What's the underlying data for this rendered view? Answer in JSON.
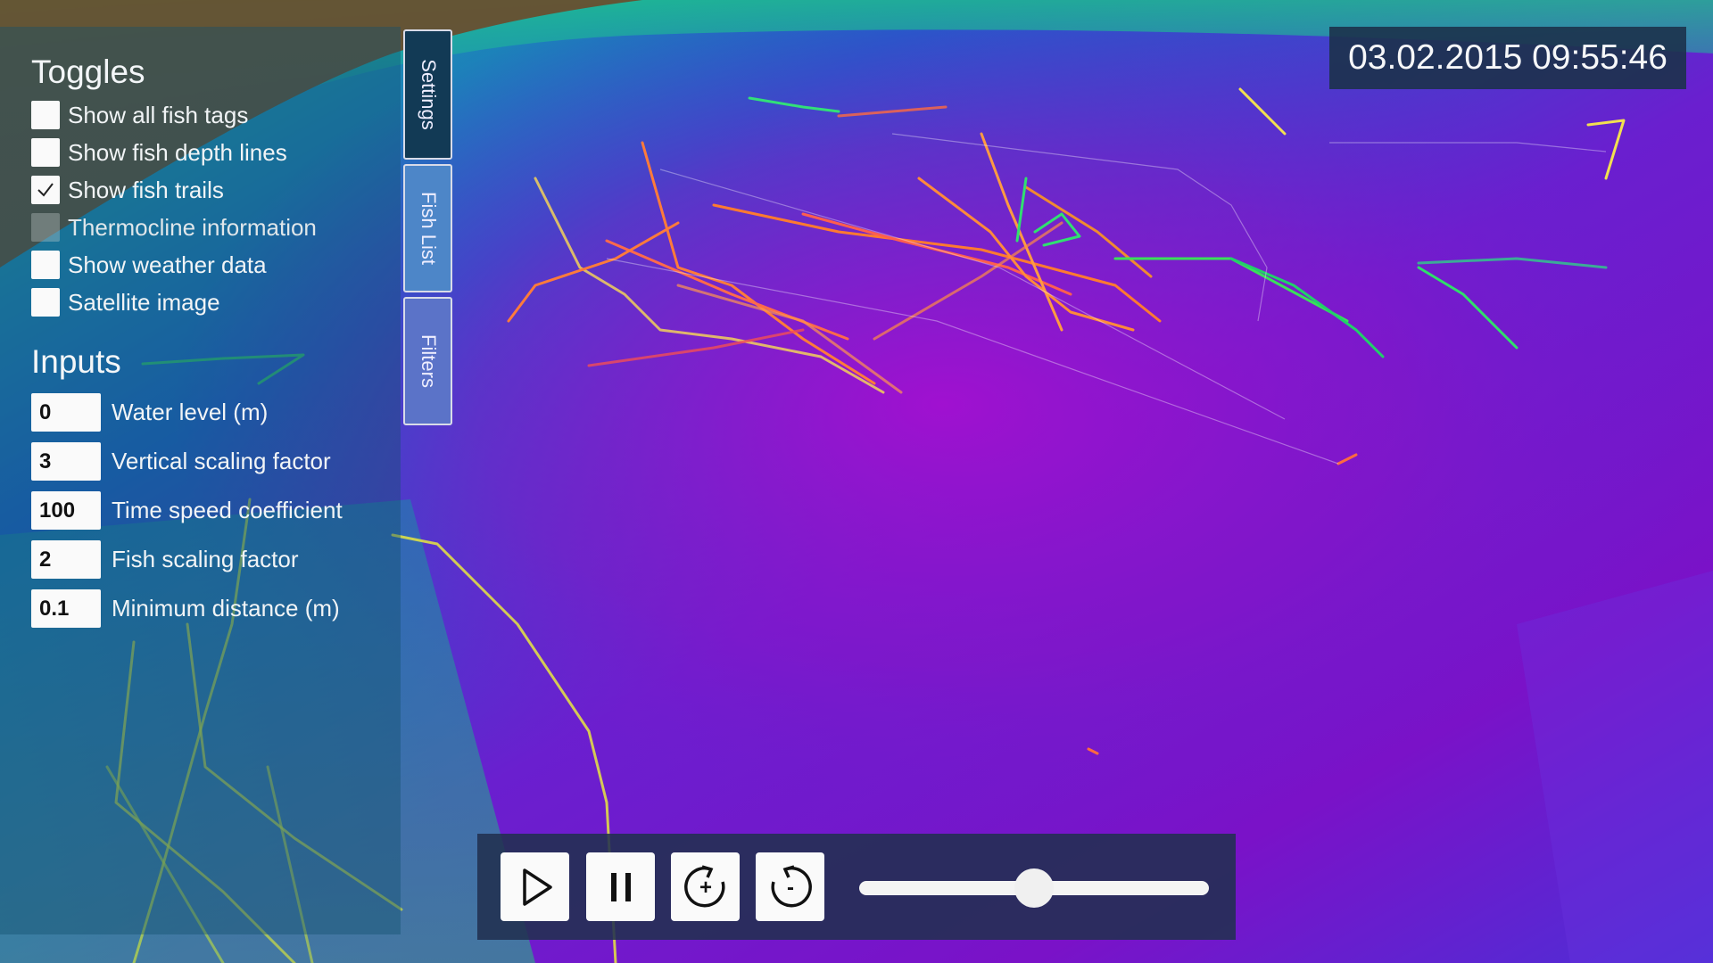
{
  "colors": {
    "panel_bg": "#14506e",
    "checkbox": "#fafafa",
    "tab_settings": "#123a55",
    "tab_fishlist": "#4d86c8",
    "tab_filters": "#5b73c8",
    "timestamp_bg": "#1c324b",
    "playback_bg": "#213050",
    "lake_deep": "#7d0fc6",
    "lake_shallow": "#1aa8a0"
  },
  "toggles": {
    "title": "Toggles",
    "items": [
      {
        "label": "Show all fish tags",
        "checked": false,
        "disabled": false
      },
      {
        "label": "Show fish depth lines",
        "checked": false,
        "disabled": false
      },
      {
        "label": "Show fish trails",
        "checked": true,
        "disabled": false
      },
      {
        "label": "Thermocline information",
        "checked": false,
        "disabled": true
      },
      {
        "label": "Show weather data",
        "checked": false,
        "disabled": false
      },
      {
        "label": "Satellite image",
        "checked": false,
        "disabled": false
      }
    ]
  },
  "inputs": {
    "title": "Inputs",
    "items": [
      {
        "value": "0",
        "label": "Water level (m)"
      },
      {
        "value": "3",
        "label": "Vertical scaling factor"
      },
      {
        "value": "100",
        "label": "Time speed coefficient"
      },
      {
        "value": "2",
        "label": "Fish scaling factor"
      },
      {
        "value": "0.1",
        "label": "Minimum distance (m)"
      }
    ]
  },
  "tabs": {
    "settings": "Settings",
    "fish_list": "Fish List",
    "filters": "Filters"
  },
  "timestamp": "03.02.2015 09:55:46",
  "playback": {
    "play_icon": "play-icon",
    "pause_icon": "pause-icon",
    "speed_up_icon": "rotate-plus-icon",
    "slow_down_icon": "rotate-minus-icon",
    "speed_up_symbol": "+",
    "slow_down_symbol": "-",
    "slider_value": 0.5
  }
}
